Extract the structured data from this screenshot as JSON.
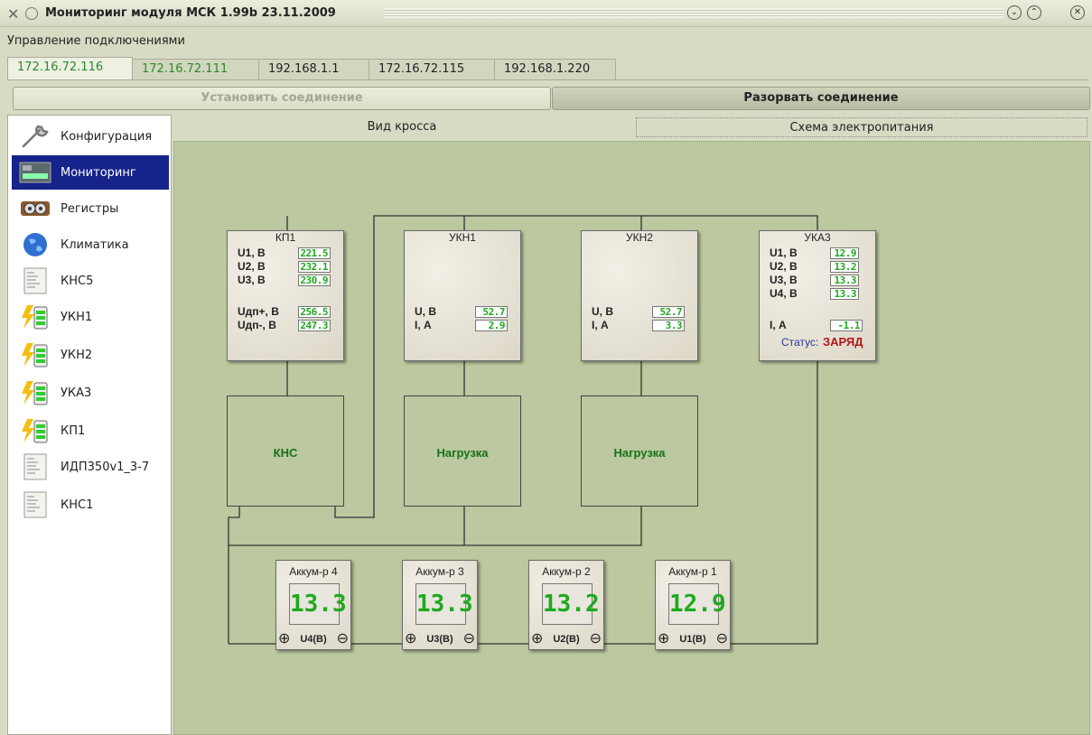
{
  "window": {
    "title": "Мониторинг модуля МСК 1.99b 23.11.2009"
  },
  "menu": {
    "connections": "Управление подключениями"
  },
  "tabs": [
    {
      "label": "172.16.72.116"
    },
    {
      "label": "172.16.72.111"
    },
    {
      "label": "192.168.1.1"
    },
    {
      "label": "172.16.72.115"
    },
    {
      "label": "192.168.1.220"
    }
  ],
  "actions": {
    "connect": "Установить соединение",
    "disconnect": "Разорвать соединение"
  },
  "sidebar": {
    "items": [
      {
        "label": "Конфигурация",
        "icon": "wrench-icon"
      },
      {
        "label": "Мониторинг",
        "icon": "monitor-icon"
      },
      {
        "label": "Регистры",
        "icon": "registers-icon"
      },
      {
        "label": "Климатика",
        "icon": "globe-icon"
      },
      {
        "label": "КНС5",
        "icon": "document-icon"
      },
      {
        "label": "УКН1",
        "icon": "battery-charge-icon"
      },
      {
        "label": "УКН2",
        "icon": "battery-charge-icon"
      },
      {
        "label": "УКА3",
        "icon": "battery-charge-icon"
      },
      {
        "label": "КП1",
        "icon": "battery-charge-icon"
      },
      {
        "label": "ИДП350v1_3-7",
        "icon": "document-icon"
      },
      {
        "label": "КНС1",
        "icon": "document-icon"
      }
    ]
  },
  "view_tabs": {
    "cross": "Вид кросса",
    "power": "Схема электропитания"
  },
  "diagram": {
    "kp1": {
      "title": "КП1",
      "rows": [
        {
          "label": "U1, В",
          "value": "221.5"
        },
        {
          "label": "U2, В",
          "value": "232.1"
        },
        {
          "label": "U3, В",
          "value": "230.9"
        },
        {
          "label": "Uдп+, В",
          "value": "256.5"
        },
        {
          "label": "Uдп-, В",
          "value": "247.3"
        }
      ]
    },
    "ukn1": {
      "title": "УКН1",
      "rows": [
        {
          "label": "U, В",
          "value": "52.7"
        },
        {
          "label": "I, А",
          "value": "2.9"
        }
      ]
    },
    "ukn2": {
      "title": "УКН2",
      "rows": [
        {
          "label": "U, В",
          "value": "52.7"
        },
        {
          "label": "I, А",
          "value": "3.3"
        }
      ]
    },
    "uka3": {
      "title": "УКА3",
      "rows": [
        {
          "label": "U1, В",
          "value": "12.9"
        },
        {
          "label": "U2, В",
          "value": "13.2"
        },
        {
          "label": "U3, В",
          "value": "13.3"
        },
        {
          "label": "U4, В",
          "value": "13.3"
        },
        {
          "label": "I, А",
          "value": "-1.1"
        }
      ],
      "status_label": "Статус:",
      "status_value": "ЗАРЯД"
    },
    "kns": "КНС",
    "load1": "Нагрузка",
    "load2": "Нагрузка",
    "batteries": [
      {
        "title": "Аккум-р 4",
        "value": "13.3",
        "terminal": "U4(В)"
      },
      {
        "title": "Аккум-р 3",
        "value": "13.3",
        "terminal": "U3(В)"
      },
      {
        "title": "Аккум-р 2",
        "value": "13.2",
        "terminal": "U2(В)"
      },
      {
        "title": "Аккум-р 1",
        "value": "12.9",
        "terminal": "U1(В)"
      }
    ],
    "terminal_plus": "⊕",
    "terminal_minus": "⊖"
  }
}
